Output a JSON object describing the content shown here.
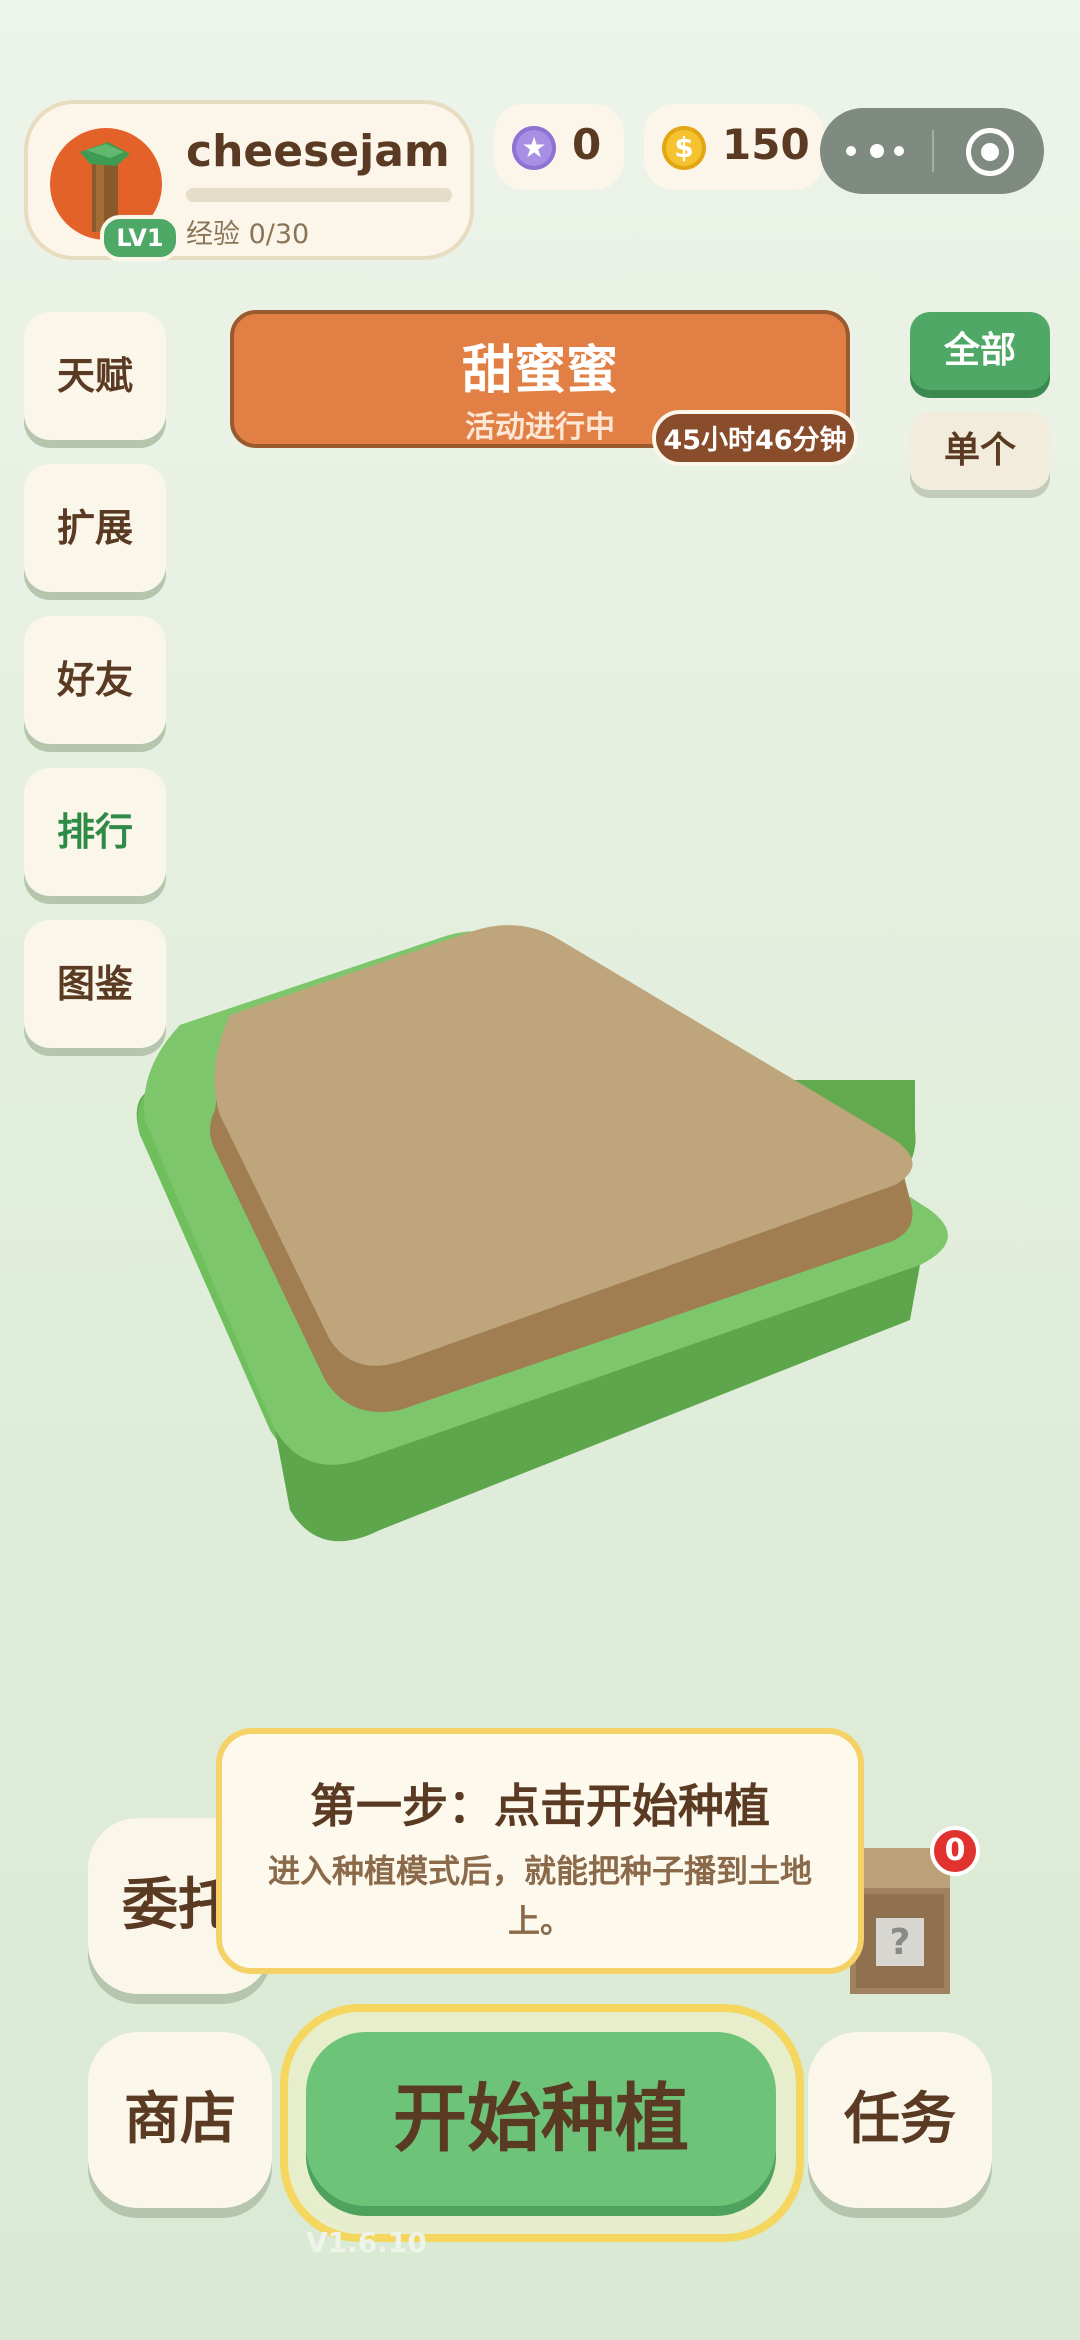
{
  "profile": {
    "username": "cheesejam",
    "level": "LV1",
    "xp_text": "经验 0/30",
    "xp_fraction": 0
  },
  "currency": {
    "stars": "0",
    "coins": "150"
  },
  "side_menu": [
    "天赋",
    "扩展",
    "好友",
    "排行",
    "图鉴"
  ],
  "event": {
    "title": "甜蜜蜜",
    "subtitle": "活动进行中",
    "timer": "45小时46分钟"
  },
  "filters": {
    "all": "全部",
    "single": "单个"
  },
  "bottom": {
    "delegate": "委托",
    "shop": "商店",
    "start": "开始种植",
    "task": "任务",
    "version": "V1.6.10"
  },
  "tooltip": {
    "title": "第一步：点击开始种植",
    "body": "进入种植模式后，就能把种子播到土地上。"
  },
  "mystery_box": {
    "badge": "0"
  },
  "colors": {
    "accent_green": "#4fa865",
    "banner_orange": "#e17f45",
    "text_brown": "#5a3a22",
    "highlight_yellow": "#f5d268"
  }
}
